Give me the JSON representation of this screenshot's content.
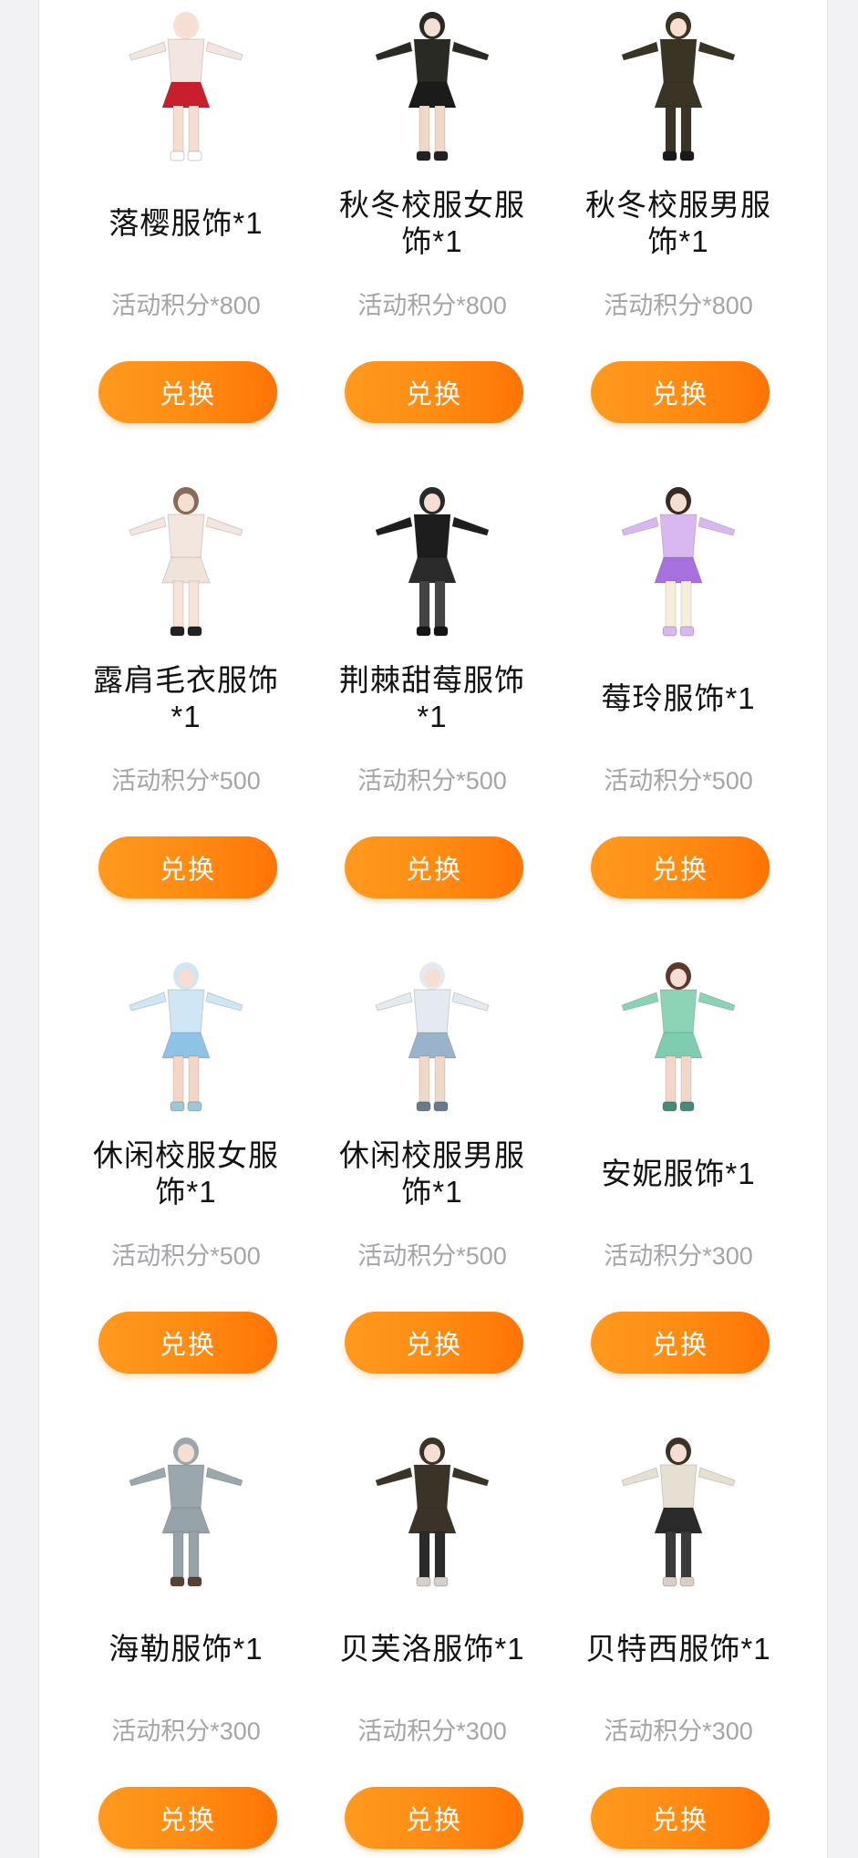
{
  "exchange_button_label": "兑换",
  "items": [
    {
      "name": "落樱服饰*1",
      "price": "活动积分*800",
      "icon": "outfit-red-dress-icon",
      "colors": {
        "top": "#f3e6e0",
        "bottom": "#c81e2e",
        "legs": "#f5ddd0",
        "shoes": "#ffffff",
        "hair": "#f7e0d6"
      }
    },
    {
      "name": "秋冬校服女服饰*1",
      "price": "活动积分*800",
      "icon": "outfit-winter-school-girl-icon",
      "colors": {
        "top": "#2a2a24",
        "bottom": "#1b1b1b",
        "legs": "#f0d8c8",
        "shoes": "#222222",
        "hair": "#2a2a24"
      }
    },
    {
      "name": "秋冬校服男服饰*1",
      "price": "活动积分*800",
      "icon": "outfit-winter-school-boy-icon",
      "colors": {
        "top": "#3a3424",
        "bottom": "#3a3424",
        "legs": "#3a3424",
        "shoes": "#1a1a1a",
        "hair": "#3a3424"
      }
    },
    {
      "name": "露肩毛衣服饰*1",
      "price": "活动积分*500",
      "icon": "outfit-off-shoulder-sweater-icon",
      "colors": {
        "top": "#f2e6de",
        "bottom": "#efe4da",
        "legs": "#f6e2d6",
        "shoes": "#222222",
        "hair": "#8a6a58"
      }
    },
    {
      "name": "荆棘甜莓服饰*1",
      "price": "活动积分*500",
      "icon": "outfit-thorn-berry-icon",
      "colors": {
        "top": "#1d1d1d",
        "bottom": "#2a2a2a",
        "legs": "#444444",
        "shoes": "#151515",
        "hair": "#2a2a2a"
      }
    },
    {
      "name": "莓玲服饰*1",
      "price": "活动积分*500",
      "icon": "outfit-purple-dress-icon",
      "colors": {
        "top": "#d9b8f0",
        "bottom": "#a770df",
        "legs": "#f7f0d8",
        "shoes": "#d9b8f0",
        "hair": "#3a2a24"
      }
    },
    {
      "name": "休闲校服女服饰*1",
      "price": "活动积分*500",
      "icon": "outfit-casual-school-girl-icon",
      "colors": {
        "top": "#cfe6f5",
        "bottom": "#8fc3e6",
        "legs": "#f3d6c6",
        "shoes": "#9dc7d8",
        "hair": "#cfe6f5"
      }
    },
    {
      "name": "休闲校服男服饰*1",
      "price": "活动积分*500",
      "icon": "outfit-casual-school-boy-icon",
      "colors": {
        "top": "#e4eaf0",
        "bottom": "#9ab3cc",
        "legs": "#f0d8c8",
        "shoes": "#6a7a8a",
        "hair": "#e4eaf0"
      }
    },
    {
      "name": "安妮服饰*1",
      "price": "活动积分*300",
      "icon": "outfit-mint-maid-icon",
      "colors": {
        "top": "#8cd3b5",
        "bottom": "#7fcdb0",
        "legs": "#f3d6c6",
        "shoes": "#4a8a7a",
        "hair": "#5a3a2a"
      }
    },
    {
      "name": "海勒服饰*1",
      "price": "活动积分*300",
      "icon": "outfit-gray-jumpsuit-icon",
      "colors": {
        "top": "#9aa7ad",
        "bottom": "#95a2a8",
        "legs": "#95a2a8",
        "shoes": "#5a4030",
        "hair": "#9aa7ad"
      }
    },
    {
      "name": "贝芙洛服饰*1",
      "price": "活动积分*300",
      "icon": "outfit-brown-shorts-icon",
      "colors": {
        "top": "#3a3428",
        "bottom": "#3a3428",
        "legs": "#2a2a2a",
        "shoes": "#d8d0c8",
        "hair": "#3a3428"
      }
    },
    {
      "name": "贝特西服饰*1",
      "price": "活动积分*300",
      "icon": "outfit-cream-coat-icon",
      "colors": {
        "top": "#e6e0d2",
        "bottom": "#2a2a2a",
        "legs": "#3a3a3a",
        "shoes": "#d8d0c8",
        "hair": "#3a3428"
      }
    }
  ]
}
